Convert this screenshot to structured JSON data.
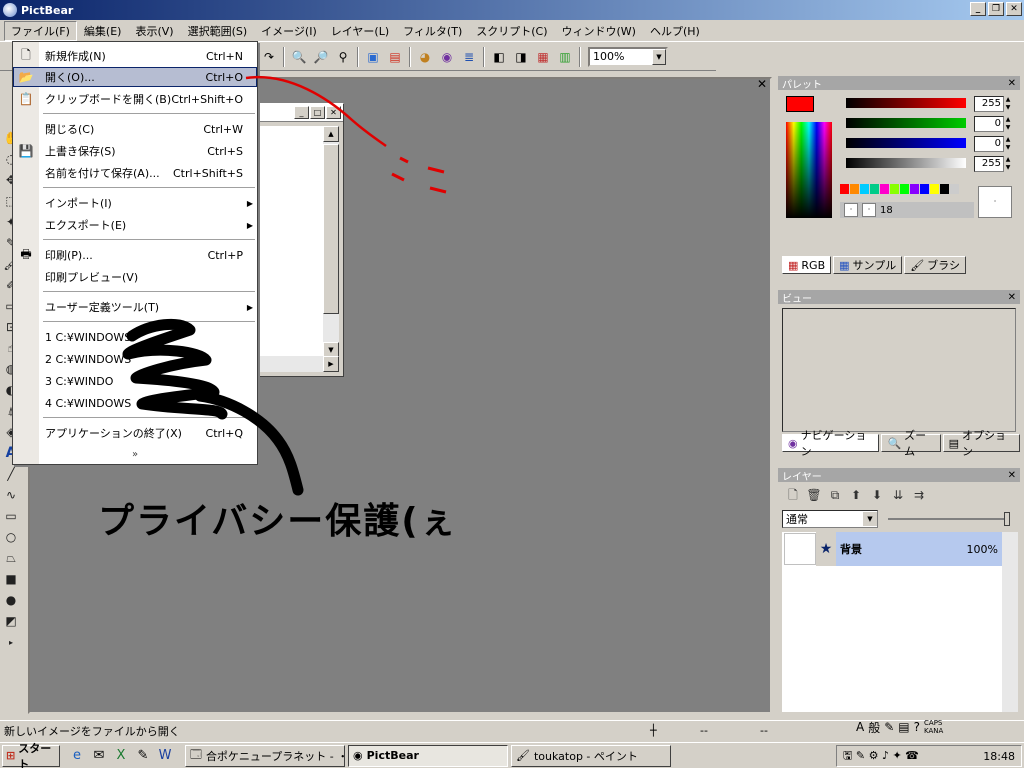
{
  "window": {
    "title": "PictBear"
  },
  "menubar": [
    "ファイル(F)",
    "編集(E)",
    "表示(V)",
    "選択範囲(S)",
    "イメージ(I)",
    "レイヤー(L)",
    "フィルタ(T)",
    "スクリプト(C)",
    "ウィンドウ(W)",
    "ヘルプ(H)"
  ],
  "toolbar": {
    "zoom": "100%"
  },
  "file_menu": {
    "items": [
      {
        "label": "新規作成(N)",
        "shortcut": "Ctrl+N",
        "icon": "new-doc-icon"
      },
      {
        "label": "開く(O)...",
        "shortcut": "Ctrl+O",
        "icon": "open-folder-icon",
        "highlighted": true
      },
      {
        "label": "クリップボードを開く(B)",
        "shortcut": "Ctrl+Shift+O",
        "icon": "clipboard-icon"
      },
      {
        "label": "閉じる(C)",
        "shortcut": "Ctrl+W"
      },
      {
        "label": "上書き保存(S)",
        "shortcut": "Ctrl+S",
        "icon": "save-icon"
      },
      {
        "label": "名前を付けて保存(A)...",
        "shortcut": "Ctrl+Shift+S"
      },
      {
        "label": "インポート(I)",
        "submenu": true
      },
      {
        "label": "エクスポート(E)",
        "submenu": true
      },
      {
        "label": "印刷(P)...",
        "shortcut": "Ctrl+P",
        "icon": "print-icon"
      },
      {
        "label": "印刷プレビュー(V)"
      },
      {
        "label": "ユーザー定義ツール(T)",
        "submenu": true
      },
      {
        "label": "1 C:¥WINDOWS"
      },
      {
        "label": "2 C:¥WINDOWS"
      },
      {
        "label": "3 C:¥WINDO"
      },
      {
        "label": "4 C:¥WINDOWS"
      },
      {
        "label": "アプリケーションの終了(X)",
        "shortcut": "Ctrl+Q"
      }
    ],
    "more": "»"
  },
  "palette": {
    "title": "パレット",
    "values": {
      "r": "255",
      "g": "0",
      "b": "0",
      "a": "255"
    },
    "brush_size": "18",
    "tabs": [
      "RGB",
      "サンプル",
      "ブラシ"
    ]
  },
  "view": {
    "title": "ビュー",
    "tabs": [
      "ナビゲーション",
      "ズーム",
      "オプション"
    ]
  },
  "layers": {
    "title": "レイヤー",
    "blend_mode": "通常",
    "items": [
      {
        "name": "背景",
        "opacity": "100%"
      }
    ]
  },
  "status": {
    "message": "新しいイメージをファイルから開く",
    "coord1": "--",
    "coord2": "--"
  },
  "taskbar": {
    "start": "スタート",
    "tasks": [
      "合ポケニュープラネット - ・・・",
      "PictBear",
      "toukatop - ペイント"
    ],
    "time": "18:48"
  },
  "overlay": {
    "text": "プライバシー保護(ぇ"
  },
  "colors": {
    "accent": "#0a246a",
    "highlight": "#b6bdd2",
    "workspace": "#808080"
  }
}
